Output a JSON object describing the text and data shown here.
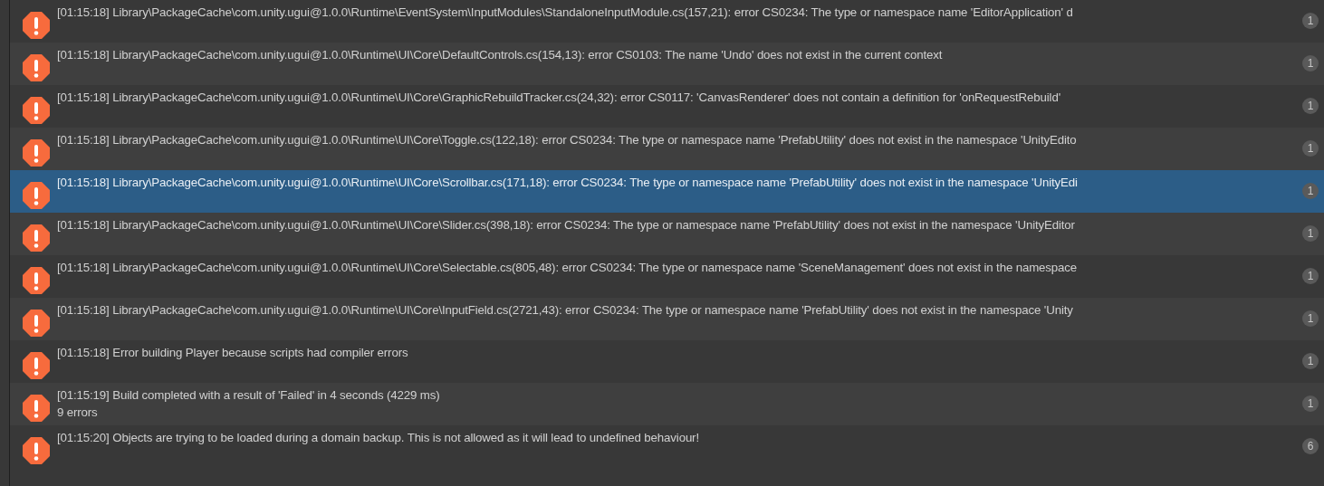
{
  "console": {
    "entries": [
      {
        "message": "[01:15:18] Library\\PackageCache\\com.unity.ugui@1.0.0\\Runtime\\EventSystem\\InputModules\\StandaloneInputModule.cs(157,21): error CS0234: The type or namespace name 'EditorApplication' d",
        "count": "1",
        "selected": false
      },
      {
        "message": "[01:15:18] Library\\PackageCache\\com.unity.ugui@1.0.0\\Runtime\\UI\\Core\\DefaultControls.cs(154,13): error CS0103: The name 'Undo' does not exist in the current context",
        "count": "1",
        "selected": false
      },
      {
        "message": "[01:15:18] Library\\PackageCache\\com.unity.ugui@1.0.0\\Runtime\\UI\\Core\\GraphicRebuildTracker.cs(24,32): error CS0117: 'CanvasRenderer' does not contain a definition for 'onRequestRebuild'",
        "count": "1",
        "selected": false
      },
      {
        "message": "[01:15:18] Library\\PackageCache\\com.unity.ugui@1.0.0\\Runtime\\UI\\Core\\Toggle.cs(122,18): error CS0234: The type or namespace name 'PrefabUtility' does not exist in the namespace 'UnityEdito",
        "count": "1",
        "selected": false
      },
      {
        "message": "[01:15:18] Library\\PackageCache\\com.unity.ugui@1.0.0\\Runtime\\UI\\Core\\Scrollbar.cs(171,18): error CS0234: The type or namespace name 'PrefabUtility' does not exist in the namespace 'UnityEdi",
        "count": "1",
        "selected": true
      },
      {
        "message": "[01:15:18] Library\\PackageCache\\com.unity.ugui@1.0.0\\Runtime\\UI\\Core\\Slider.cs(398,18): error CS0234: The type or namespace name 'PrefabUtility' does not exist in the namespace 'UnityEditor",
        "count": "1",
        "selected": false
      },
      {
        "message": "[01:15:18] Library\\PackageCache\\com.unity.ugui@1.0.0\\Runtime\\UI\\Core\\Selectable.cs(805,48): error CS0234: The type or namespace name 'SceneManagement' does not exist in the namespace",
        "count": "1",
        "selected": false
      },
      {
        "message": "[01:15:18] Library\\PackageCache\\com.unity.ugui@1.0.0\\Runtime\\UI\\Core\\InputField.cs(2721,43): error CS0234: The type or namespace name 'PrefabUtility' does not exist in the namespace 'Unity",
        "count": "1",
        "selected": false
      },
      {
        "message": "[01:15:18] Error building Player because scripts had compiler errors",
        "count": "1",
        "selected": false
      },
      {
        "message": "[01:15:19] Build completed with a result of 'Failed' in 4 seconds (4229 ms)",
        "detail": "9 errors",
        "count": "1",
        "selected": false
      },
      {
        "message": "[01:15:20] Objects are trying to be loaded during a domain backup. This is not allowed as it will lead to undefined behaviour!",
        "count": "6",
        "selected": false
      }
    ]
  }
}
